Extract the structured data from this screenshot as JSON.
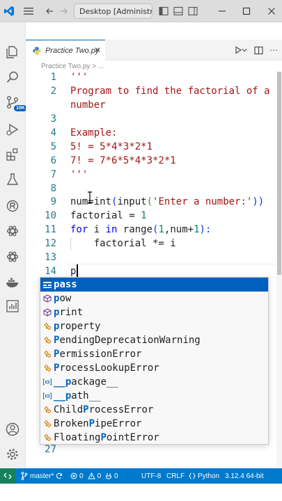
{
  "titlebar": {
    "search_text": "Desktop [Administrator]"
  },
  "activity": {
    "badge": "10K"
  },
  "tab": {
    "filename": "Practice Two.py"
  },
  "breadcrumb": {
    "text": "Practice Two.py > ..."
  },
  "editor": {
    "line_numbers": [
      "1",
      "2",
      "3",
      "4",
      "5",
      "6",
      "7",
      "8",
      "9",
      "10",
      "11",
      "12",
      "13",
      "14"
    ],
    "bottom_line_number": "27",
    "lines": {
      "l1": "'''",
      "l2": "Program to find the factorial of a",
      "l2b": "number",
      "l4": "Example:",
      "l5": "5! = 5*4*3*2*1",
      "l6": "7! = 7*6*5*4*3*2*1",
      "l7": "'''",
      "l9_a": "num=",
      "l9_b": "int",
      "l9_c": "(",
      "l9_d": "input",
      "l9_e": "(",
      "l9_f": "'Enter a number:'",
      "l9_g": "))",
      "l10_a": "factorial = ",
      "l10_b": "1",
      "l11_a": "for",
      "l11_b": " i ",
      "l11_c": "in",
      "l11_d": " ",
      "l11_e": "range",
      "l11_f": "(",
      "l11_g": "1",
      "l11_h": ",num+",
      "l11_i": "1",
      "l11_j": "):",
      "l12": "    factorial *= i",
      "l14": "p"
    }
  },
  "suggestions": [
    {
      "first": "p",
      "rest": "ass",
      "icon": "keyword-icon"
    },
    {
      "first": "p",
      "rest": "ow",
      "icon": "method-icon"
    },
    {
      "first": "p",
      "rest": "rint",
      "icon": "method-icon"
    },
    {
      "first": "p",
      "rest": "roperty",
      "icon": "class-icon"
    },
    {
      "first": "P",
      "rest": "endingDeprecationWarning",
      "icon": "class-icon"
    },
    {
      "first": "P",
      "rest": "ermissionError",
      "icon": "class-icon"
    },
    {
      "first": "P",
      "rest": "rocessLookupError",
      "icon": "class-icon"
    },
    {
      "first": "__p",
      "rest": "ackage__",
      "icon": "variable-icon"
    },
    {
      "first": "__p",
      "rest": "ath__",
      "icon": "variable-icon"
    },
    {
      "pre": "Child",
      "first": "P",
      "rest": "rocessError",
      "icon": "class-icon"
    },
    {
      "pre": "Broken",
      "first": "P",
      "rest": "ipeError",
      "icon": "class-icon"
    },
    {
      "pre": "Floating",
      "first": "P",
      "rest": "ointError",
      "icon": "class-icon"
    }
  ],
  "statusbar": {
    "branch": "master*",
    "errors": "0",
    "warnings": "0",
    "ports": "0",
    "encoding": "UTF-8",
    "eol": "CRLF",
    "language": "Python",
    "interpreter": "3.12.4 64-bit"
  },
  "colors": {
    "accent": "#007acc",
    "selection": "#0060c0",
    "string": "#a31515",
    "keyword": "#0000ff",
    "number": "#098658",
    "line_number": "#237893"
  }
}
